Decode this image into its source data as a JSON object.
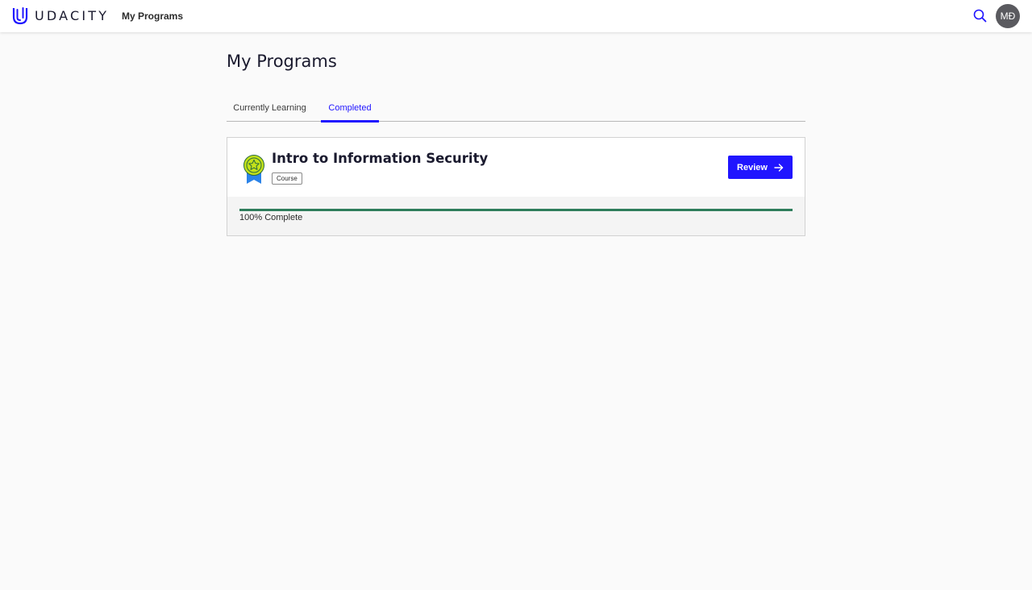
{
  "header": {
    "logo_text": "UDACITY",
    "nav_link": "My Programs",
    "avatar_initials": "MĐ",
    "search_icon": "search-icon"
  },
  "page": {
    "title": "My Programs"
  },
  "tabs": [
    {
      "label": "Currently Learning",
      "active": false
    },
    {
      "label": "Completed",
      "active": true
    }
  ],
  "program": {
    "title": "Intro to Information Security",
    "type": "Course",
    "button_label": "Review",
    "progress_fraction": 1.0,
    "progress_text": "100% Complete",
    "icon": "award-ribbon-icon"
  },
  "colors": {
    "accent": "#2015ff",
    "progress": "#2e7d5b",
    "badge_green": "#c4e21a"
  }
}
